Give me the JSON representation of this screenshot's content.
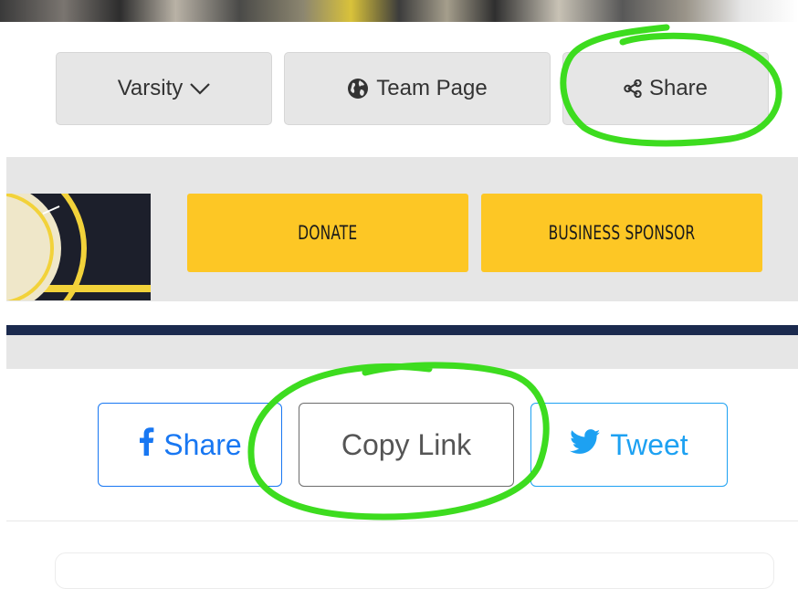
{
  "header": {
    "varsity_label": "Varsity",
    "team_page_label": "Team Page",
    "share_label": "Share"
  },
  "sponsor": {
    "donate_label": "DONATE",
    "business_sponsor_label": "BUSINESS SPONSOR"
  },
  "share_bar": {
    "facebook_label": "Share",
    "copy_link_label": "Copy Link",
    "tweet_label": "Tweet"
  },
  "colors": {
    "accent_yellow": "#fdc725",
    "navy": "#1b2a4e",
    "facebook_blue": "#1877f2",
    "twitter_blue": "#1da1f2",
    "annotation_green": "#3ddc1f"
  },
  "icons": [
    "chevron-down-icon",
    "globe-icon",
    "share-nodes-icon",
    "facebook-icon",
    "twitter-icon"
  ]
}
